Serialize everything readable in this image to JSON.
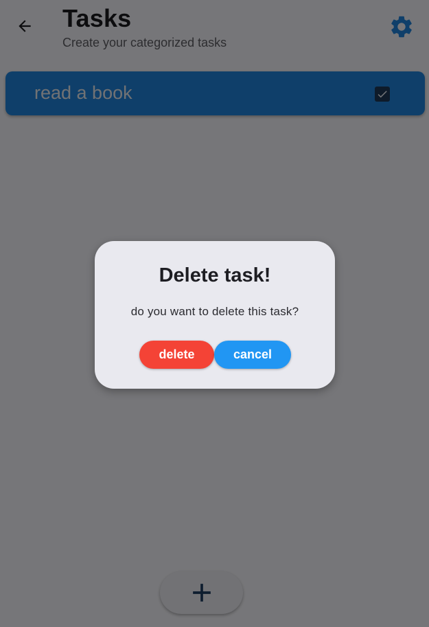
{
  "header": {
    "back_icon": "arrow-left-icon",
    "title": "Tasks",
    "subtitle": "Create your categorized tasks",
    "settings_icon": "gear-icon"
  },
  "tasks": [
    {
      "label": "read a book",
      "checked": true
    }
  ],
  "fab": {
    "icon": "plus-icon"
  },
  "dialog": {
    "title": "Delete task!",
    "message": "do you want to delete this task?",
    "delete_label": "delete",
    "cancel_label": "cancel"
  },
  "colors": {
    "primary": "#1f7fd4",
    "delete": "#f44336",
    "cancel": "#2196f3",
    "background": "#ededf2"
  }
}
